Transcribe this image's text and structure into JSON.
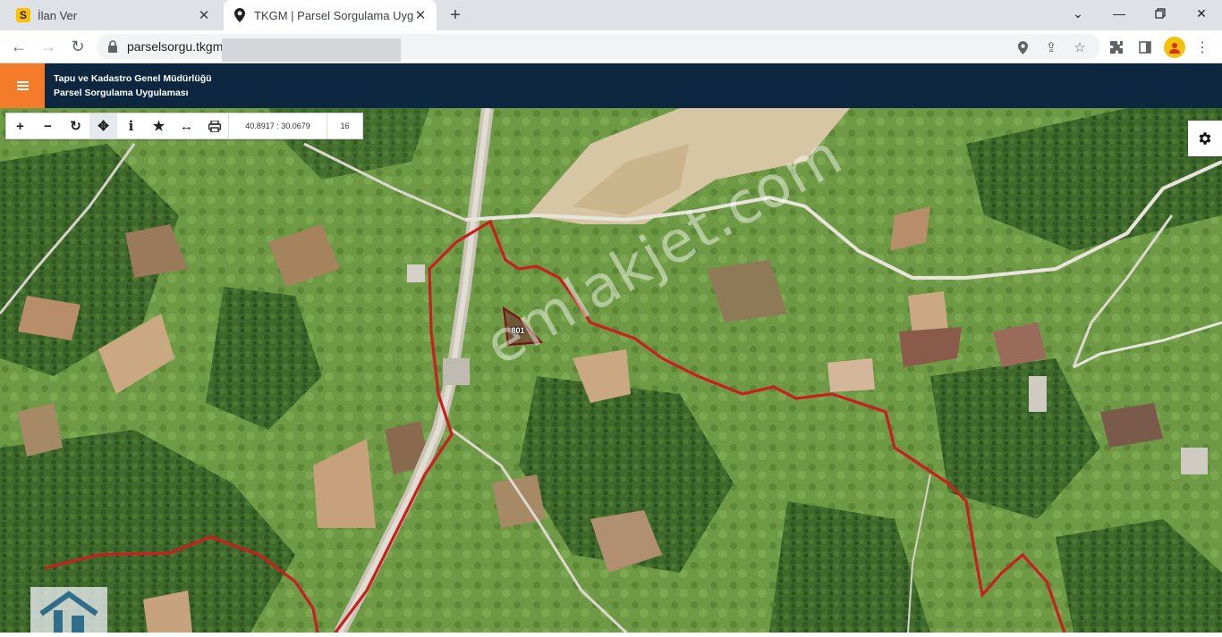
{
  "browser": {
    "tabs": [
      {
        "title": "İlan Ver",
        "favicon": "S",
        "active": false
      },
      {
        "title": "TKGM | Parsel Sorgulama Uygula",
        "favicon": "location-pin",
        "active": true
      }
    ],
    "address": {
      "url": "parselsorgu.tkgm.gov.tr/#ara/idari/"
    }
  },
  "app": {
    "org_name": "Tapu ve Kadastro Genel Müdürlüğü",
    "app_name": "Parsel Sorgulama Uygulaması"
  },
  "map": {
    "coordinates": "40.8917 : 30.0679",
    "zoom_level": "16",
    "parcel_label": "801",
    "watermark": "emlakjet.com",
    "colors": {
      "boundary": "#c8201e",
      "parcel_fill": "#6b1f2a",
      "header_bg": "#0d2740",
      "menu_accent": "#f47b2a"
    }
  }
}
